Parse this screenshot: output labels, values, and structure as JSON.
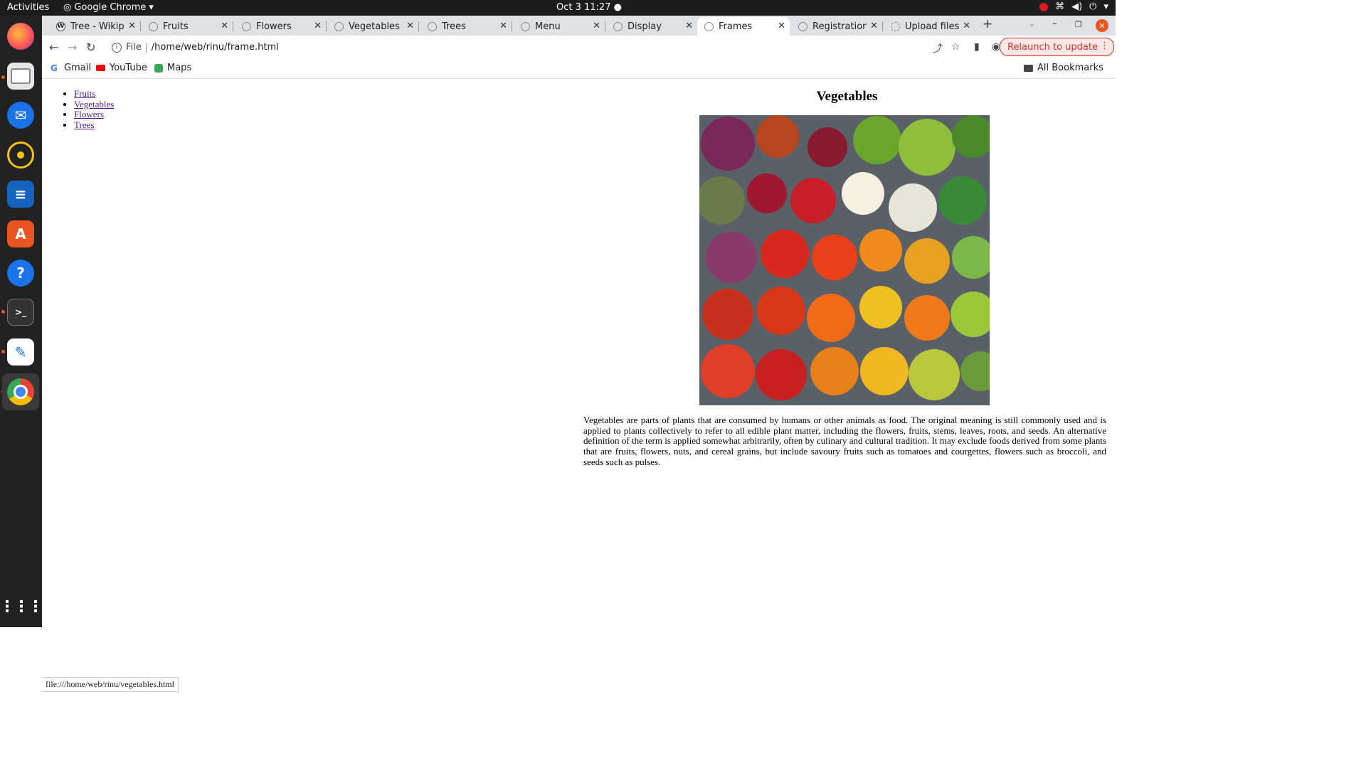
{
  "system_bar": {
    "activities": "Activities",
    "app_name": "Google Chrome",
    "clock": "Oct 3  11:27"
  },
  "tabs": [
    {
      "label": "Tree - Wikipe",
      "favicon": "wikipedia-icon",
      "active": false
    },
    {
      "label": "Fruits",
      "favicon": "globe-icon",
      "active": false
    },
    {
      "label": "Flowers",
      "favicon": "globe-icon",
      "active": false
    },
    {
      "label": "Vegetables",
      "favicon": "globe-icon",
      "active": false
    },
    {
      "label": "Trees",
      "favicon": "globe-icon",
      "active": false
    },
    {
      "label": "Menu",
      "favicon": "globe-icon",
      "active": false
    },
    {
      "label": "Display",
      "favicon": "globe-icon",
      "active": false
    },
    {
      "label": "Frames",
      "favicon": "globe-icon",
      "active": true
    },
    {
      "label": "Registration f",
      "favicon": "globe-icon",
      "active": false
    },
    {
      "label": "Upload files",
      "favicon": "loading-icon",
      "active": false
    }
  ],
  "toolbar": {
    "scheme_label": "File",
    "url": "/home/web/rinu/frame.html",
    "relaunch_label": "Relaunch to update"
  },
  "bookmarks": {
    "items": [
      "Gmail",
      "YouTube",
      "Maps"
    ],
    "all_label": "All Bookmarks"
  },
  "left_frame": {
    "links": [
      "Fruits",
      "Vegetables",
      "Flowers",
      "Trees"
    ]
  },
  "right_frame": {
    "heading": "Vegetables",
    "body": "Vegetables are parts of plants that are consumed by humans or other animals as food. The original meaning is still commonly used and is applied to plants collectively to refer to all edible plant matter, including the flowers, fruits, stems, leaves, roots, and seeds. An alternative definition of the term is applied somewhat arbitrarily, often by culinary and cultural tradition. It may exclude foods derived from some plants that are fruits, flowers, nuts, and cereal grains, but include savoury fruits such as tomatoes and courgettes, flowers such as broccoli, and seeds such as pulses."
  },
  "status_bar": {
    "hover_url": "file:///home/web/rinu/vegetables.html"
  },
  "colors": {
    "accent": "#e95420",
    "link_visited": "#551a8b",
    "relaunch": "#d93025"
  }
}
